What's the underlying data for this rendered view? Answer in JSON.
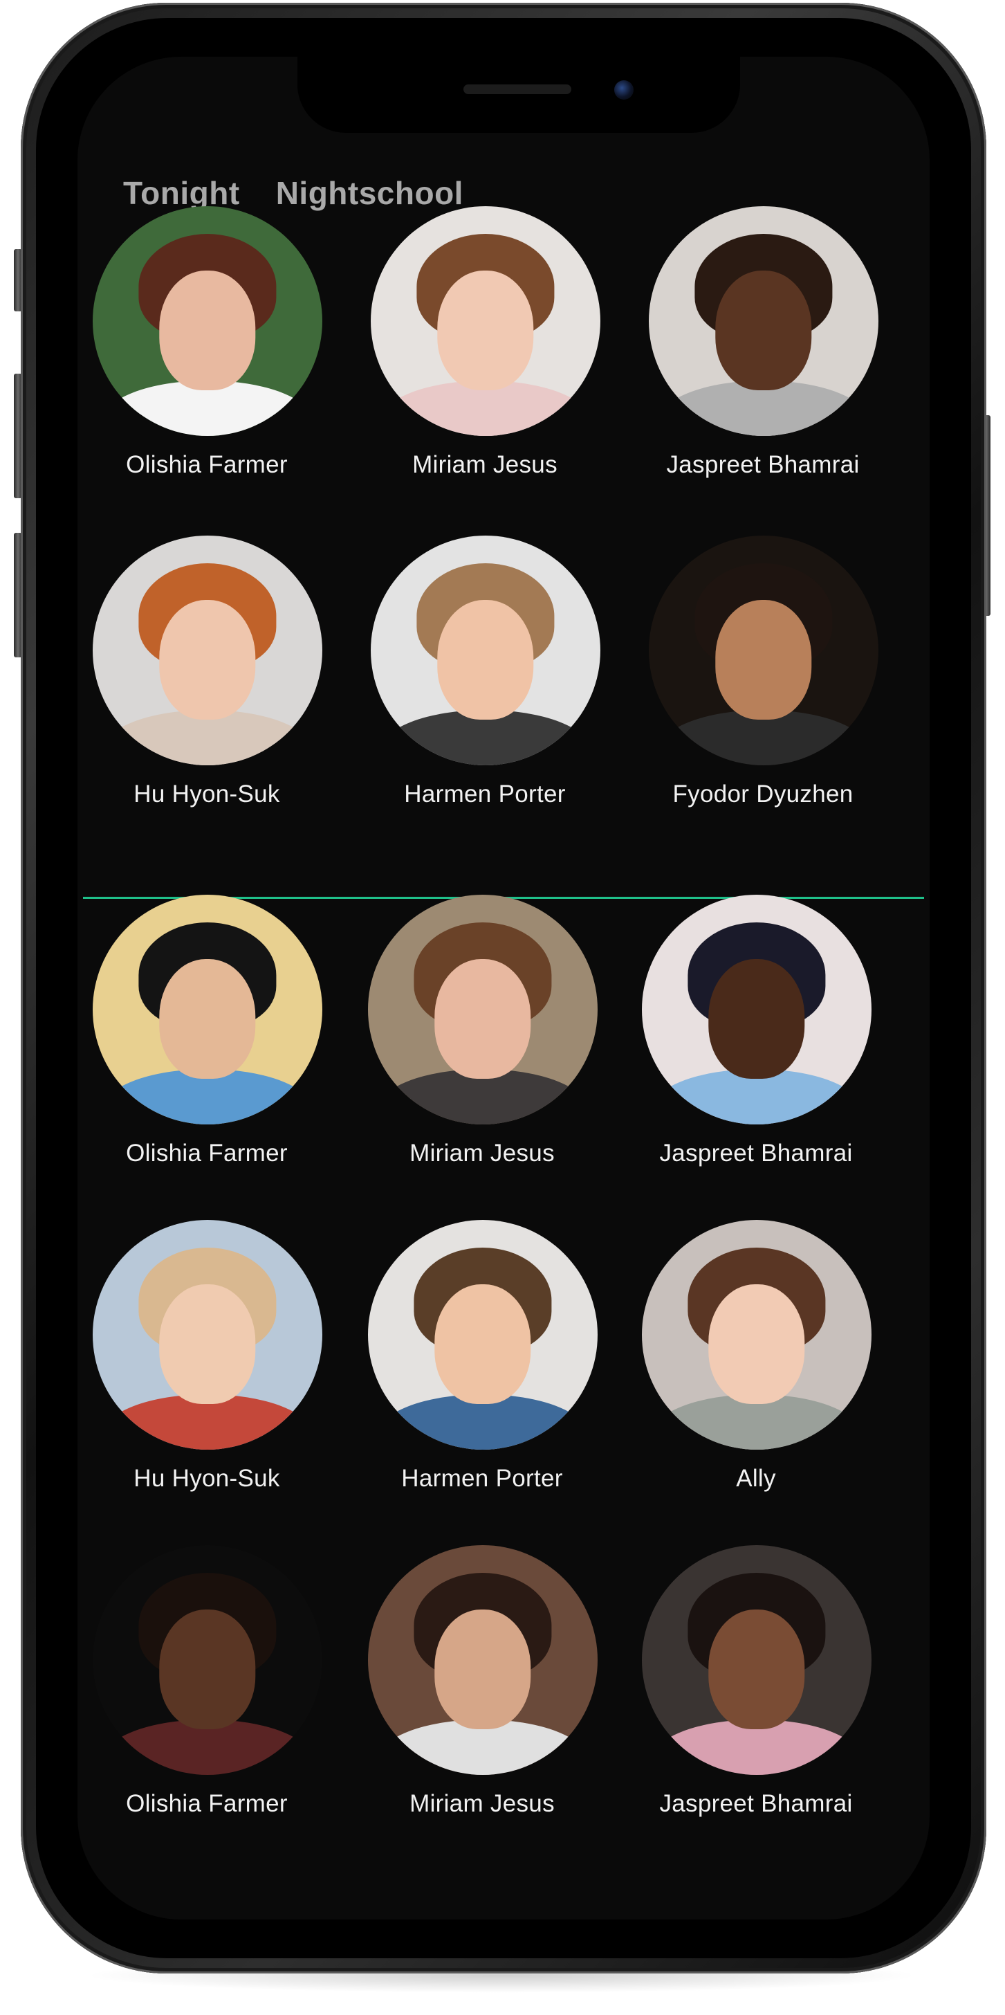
{
  "tabs": [
    {
      "label": "Tonight"
    },
    {
      "label": "Nightschool"
    }
  ],
  "accent_color": "#1fc08a",
  "section_top": {
    "people": [
      {
        "name": "Olishia Farmer",
        "bg": "#3f6a3a",
        "skin": "#e8b9a0",
        "hair": "#5a2a1c",
        "top": "#f4f4f4"
      },
      {
        "name": "Miriam Jesus",
        "bg": "#e6e2df",
        "skin": "#f1c9b3",
        "hair": "#7a4a2c",
        "top": "#e9c9c8"
      },
      {
        "name": "Jaspreet Bhamrai",
        "bg": "#d8d3cf",
        "skin": "#5a3522",
        "hair": "#2a1a12",
        "top": "#b0b0b0"
      },
      {
        "name": "Hu Hyon-Suk",
        "bg": "#d9d7d6",
        "skin": "#efc6ad",
        "hair": "#c0622a",
        "top": "#d8c8bb"
      },
      {
        "name": "Harmen Porter",
        "bg": "#e3e3e3",
        "skin": "#f0c3a6",
        "hair": "#a37a54",
        "top": "#3a3a3a"
      },
      {
        "name": "Fyodor Dyuzhen",
        "bg": "#1a1410",
        "skin": "#b8805a",
        "hair": "#1e1410",
        "top": "#2b2b2b"
      }
    ]
  },
  "section_bottom": {
    "people": [
      {
        "name": "Olishia Farmer",
        "bg": "#e8d090",
        "skin": "#e4b896",
        "hair": "#141414",
        "top": "#5a9ad0"
      },
      {
        "name": "Miriam Jesus",
        "bg": "#9d8a72",
        "skin": "#e8b8a0",
        "hair": "#6a4228",
        "top": "#3e3a3a"
      },
      {
        "name": "Jaspreet Bhamrai",
        "bg": "#e8e0e0",
        "skin": "#4a2a1a",
        "hair": "#1a1a2a",
        "top": "#8ab8e0"
      },
      {
        "name": "Hu Hyon-Suk",
        "bg": "#b8c8d8",
        "skin": "#f0cbb0",
        "hair": "#d9b890",
        "top": "#c4483a"
      },
      {
        "name": "Harmen Porter",
        "bg": "#e4e2e0",
        "skin": "#efc3a4",
        "hair": "#5a3e28",
        "top": "#3e6a9a"
      },
      {
        "name": "Ally",
        "bg": "#c8c0bc",
        "skin": "#f2cbb4",
        "hair": "#5a3624",
        "top": "#9aa09a"
      },
      {
        "name": "Olishia Farmer",
        "bg": "#0c0c0c",
        "skin": "#5a3624",
        "hair": "#1a100c",
        "top": "#5a2424"
      },
      {
        "name": "Miriam Jesus",
        "bg": "#6a4a3a",
        "skin": "#d6a688",
        "hair": "#2a1a14",
        "top": "#e0e0e0"
      },
      {
        "name": "Jaspreet Bhamrai",
        "bg": "#3a3432",
        "skin": "#7a4c34",
        "hair": "#1a1210",
        "top": "#d8a0b0"
      }
    ]
  }
}
